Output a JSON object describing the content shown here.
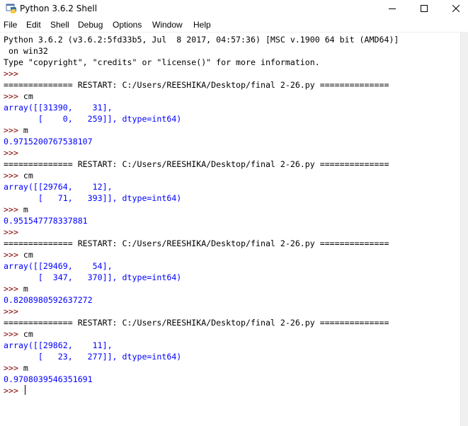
{
  "window": {
    "title": "Python 3.6.2 Shell",
    "controls": {
      "minimize": "minimize",
      "maximize": "maximize",
      "close": "close"
    }
  },
  "menu": {
    "items": [
      "File",
      "Edit",
      "Shell",
      "Debug",
      "Options",
      "Window",
      "Help"
    ]
  },
  "colors": {
    "prompt": "#800000",
    "output": "#0000ff",
    "text": "#000000"
  },
  "console": {
    "lines": [
      {
        "t": "out",
        "text": "Python 3.6.2 (v3.6.2:5fd33b5, Jul  8 2017, 04:57:36) [MSC v.1900 64 bit (AMD64)]"
      },
      {
        "t": "out",
        "text": " on win32"
      },
      {
        "t": "out",
        "text": "Type \"copyright\", \"credits\" or \"license()\" for more information."
      },
      {
        "t": "prompt",
        "text": ">>> ",
        "input": ""
      },
      {
        "t": "restart",
        "text": "============== RESTART: C:/Users/REESHIKA/Desktop/final 2-26.py =============="
      },
      {
        "t": "prompt",
        "text": ">>> ",
        "input": "cm"
      },
      {
        "t": "result",
        "text": "array([[31390,    31],"
      },
      {
        "t": "result",
        "text": "       [    0,   259]], dtype=int64)"
      },
      {
        "t": "prompt",
        "text": ">>> ",
        "input": "m"
      },
      {
        "t": "result",
        "text": "0.9715200767538107"
      },
      {
        "t": "prompt",
        "text": ">>> ",
        "input": ""
      },
      {
        "t": "restart",
        "text": "============== RESTART: C:/Users/REESHIKA/Desktop/final 2-26.py =============="
      },
      {
        "t": "prompt",
        "text": ">>> ",
        "input": "cm"
      },
      {
        "t": "result",
        "text": "array([[29764,    12],"
      },
      {
        "t": "result",
        "text": "       [   71,   393]], dtype=int64)"
      },
      {
        "t": "prompt",
        "text": ">>> ",
        "input": "m"
      },
      {
        "t": "result",
        "text": "0.951547778337881"
      },
      {
        "t": "prompt",
        "text": ">>> ",
        "input": ""
      },
      {
        "t": "restart",
        "text": "============== RESTART: C:/Users/REESHIKA/Desktop/final 2-26.py =============="
      },
      {
        "t": "prompt",
        "text": ">>> ",
        "input": "cm"
      },
      {
        "t": "result",
        "text": "array([[29469,    54],"
      },
      {
        "t": "result",
        "text": "       [  347,   370]], dtype=int64)"
      },
      {
        "t": "prompt",
        "text": ">>> ",
        "input": "m"
      },
      {
        "t": "result",
        "text": "0.8208980592637272"
      },
      {
        "t": "prompt",
        "text": ">>> ",
        "input": ""
      },
      {
        "t": "restart",
        "text": "============== RESTART: C:/Users/REESHIKA/Desktop/final 2-26.py =============="
      },
      {
        "t": "prompt",
        "text": ">>> ",
        "input": "cm"
      },
      {
        "t": "result",
        "text": "array([[29862,    11],"
      },
      {
        "t": "result",
        "text": "       [   23,   277]], dtype=int64)"
      },
      {
        "t": "prompt",
        "text": ">>> ",
        "input": "m"
      },
      {
        "t": "result",
        "text": "0.9708039546351691"
      },
      {
        "t": "prompt",
        "text": ">>> ",
        "input": "",
        "current": true
      }
    ]
  }
}
